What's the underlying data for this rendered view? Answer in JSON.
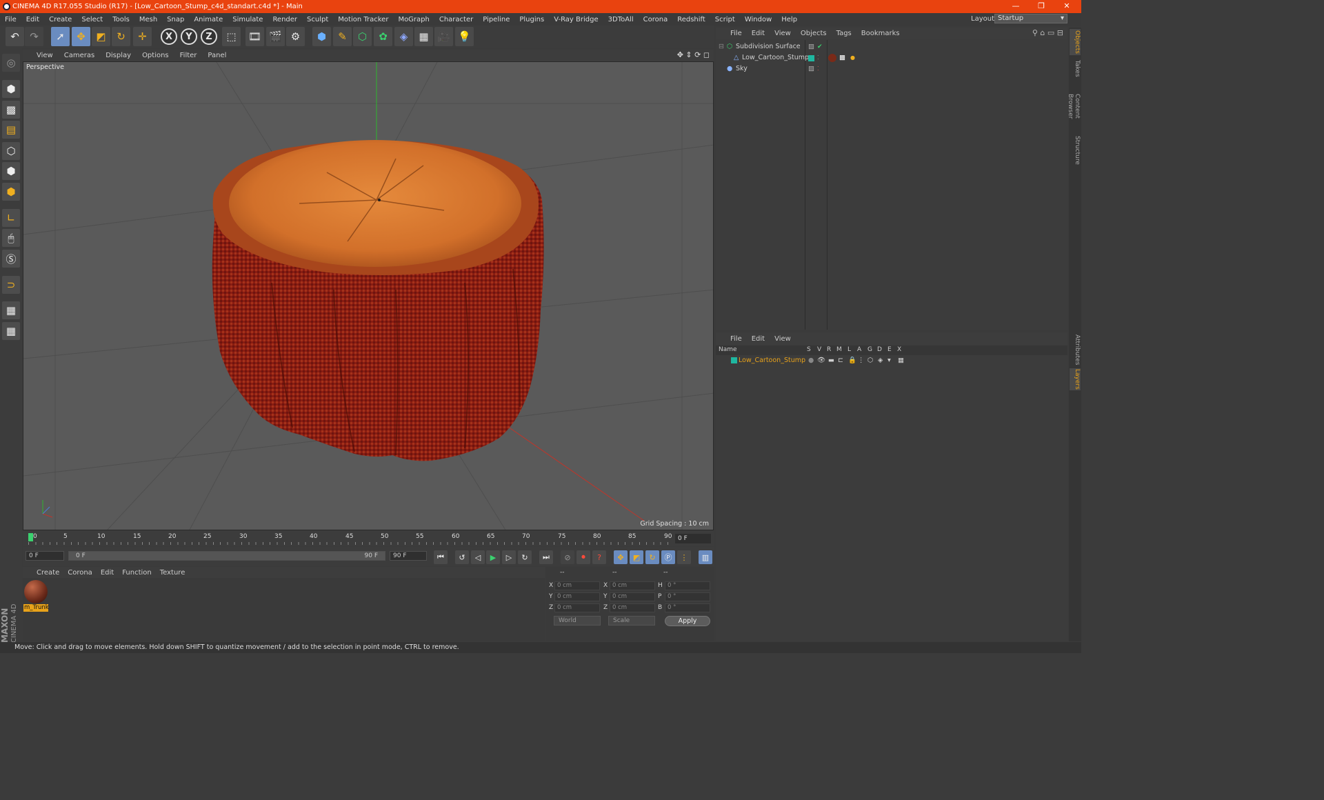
{
  "window": {
    "title": "CINEMA 4D R17.055 Studio (R17) - [Low_Cartoon_Stump_c4d_standart.c4d *] - Main"
  },
  "menu": [
    "File",
    "Edit",
    "Create",
    "Select",
    "Tools",
    "Mesh",
    "Snap",
    "Animate",
    "Simulate",
    "Render",
    "Sculpt",
    "Motion Tracker",
    "MoGraph",
    "Character",
    "Pipeline",
    "Plugins",
    "V-Ray Bridge",
    "3DToAll",
    "Corona",
    "Redshift",
    "Script",
    "Window",
    "Help"
  ],
  "layout": {
    "label": "Layout:",
    "value": "Startup"
  },
  "toolbar": {
    "axis_x": "X",
    "axis_y": "Y",
    "axis_z": "Z"
  },
  "viewport": {
    "menu": [
      "View",
      "Cameras",
      "Display",
      "Options",
      "Filter",
      "Panel"
    ],
    "label": "Perspective",
    "grid_spacing": "Grid Spacing : 10 cm"
  },
  "timeline": {
    "ticks": [
      "0",
      "5",
      "10",
      "15",
      "20",
      "25",
      "30",
      "35",
      "40",
      "45",
      "50",
      "55",
      "60",
      "65",
      "70",
      "75",
      "80",
      "85",
      "90"
    ],
    "current_frame": "0 F",
    "start_field": "0 F",
    "range_start": "0 F",
    "range_end": "90 F",
    "end_field": "90 F"
  },
  "material_manager": {
    "menu": [
      "Create",
      "Corona",
      "Edit",
      "Function",
      "Texture"
    ],
    "material_name": "m_Trunk"
  },
  "coordinates": {
    "headers": [
      "--",
      "--",
      "--"
    ],
    "rows": [
      {
        "l1": "X",
        "v1": "0 cm",
        "l2": "X",
        "v2": "0 cm",
        "l3": "H",
        "v3": "0 °"
      },
      {
        "l1": "Y",
        "v1": "0 cm",
        "l2": "Y",
        "v2": "0 cm",
        "l3": "P",
        "v3": "0 °"
      },
      {
        "l1": "Z",
        "v1": "0 cm",
        "l2": "Z",
        "v2": "0 cm",
        "l3": "B",
        "v3": "0 °"
      }
    ],
    "space": "World",
    "mode": "Scale",
    "apply": "Apply"
  },
  "branding": {
    "maxon": "MAXON",
    "product": "CINEMA 4D"
  },
  "status": "Move: Click and drag to move elements. Hold down SHIFT to quantize movement / add to the selection in point mode, CTRL to remove.",
  "object_manager": {
    "menu": [
      "File",
      "Edit",
      "View",
      "Objects",
      "Tags",
      "Bookmarks"
    ],
    "objects": [
      {
        "name": "Subdivision Surface"
      },
      {
        "name": "Low_Cartoon_Stump"
      },
      {
        "name": "Sky"
      }
    ]
  },
  "layer_manager": {
    "menu": [
      "File",
      "Edit",
      "View"
    ],
    "columns": [
      "Name",
      "S",
      "V",
      "R",
      "M",
      "L",
      "A",
      "G",
      "D",
      "E",
      "X"
    ],
    "layers": [
      {
        "name": "Low_Cartoon_Stump"
      }
    ]
  },
  "right_tabs": [
    "Objects",
    "Takes",
    "Content Browser",
    "Structure",
    "Attributes",
    "Layers"
  ],
  "colors": {
    "accent": "#e9430f",
    "selection": "#e8a21a",
    "layer_color": "#1fb7a0"
  }
}
